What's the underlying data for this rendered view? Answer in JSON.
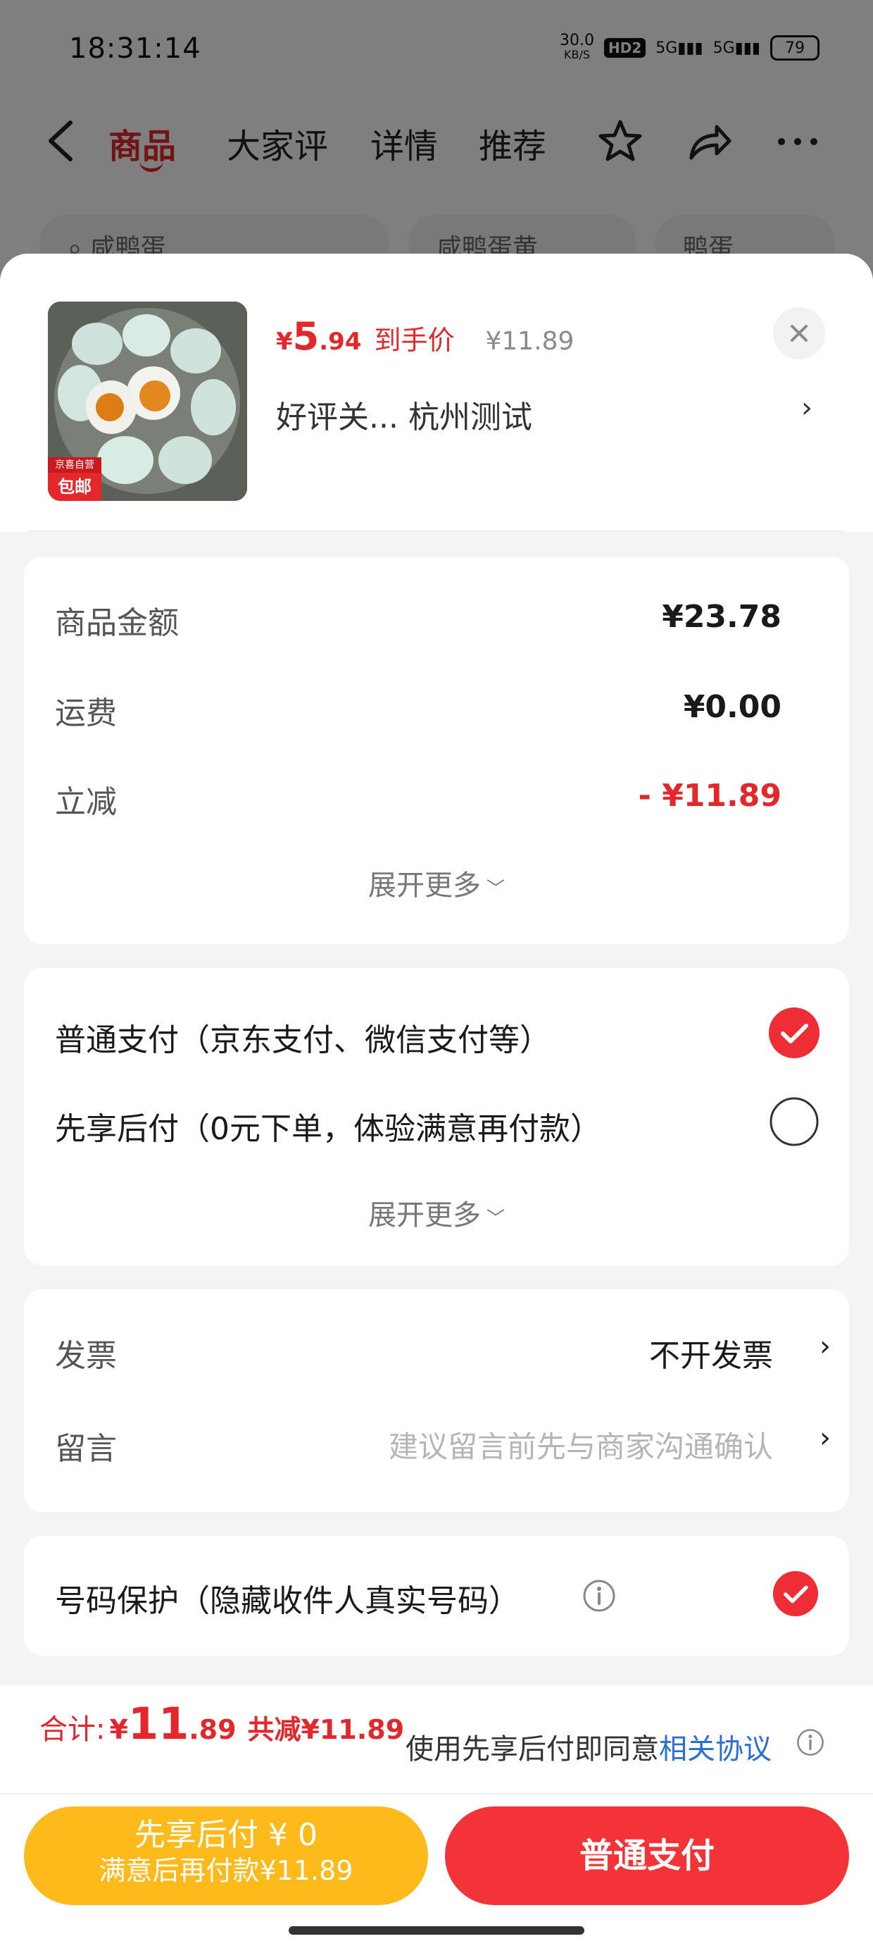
{
  "status_bar": {
    "time": "18:31:14",
    "net_speed": "30.0",
    "net_unit": "KB/S",
    "hd_label": "HD2",
    "sig1": "5G",
    "sig2": "5G",
    "battery": "79"
  },
  "nav": {
    "tabs": [
      "商品",
      "大家评",
      "详情",
      "推荐"
    ],
    "active_tab": "商品",
    "icons": [
      "back-icon",
      "star-icon",
      "share-icon",
      "more-icon"
    ],
    "chips": [
      "咸鸭蛋",
      "咸鸭蛋黄",
      "鸭蛋"
    ]
  },
  "product": {
    "badge_top": "京喜自营",
    "badge_main": "包邮",
    "price_currency": "¥",
    "price_int": "5",
    "price_dec": ".94",
    "price_tag": "到手价",
    "original_price": "¥11.89",
    "desc": "好评关...  杭州测试",
    "desc_chevron": "›"
  },
  "cost": {
    "rows": [
      {
        "label": "商品金额",
        "value": "¥23.78"
      },
      {
        "label": "运费",
        "value": "¥0.00"
      },
      {
        "label": "立减",
        "value": "- ¥11.89"
      }
    ],
    "expand_label": "展开更多"
  },
  "payment": {
    "options": [
      {
        "label": "普通支付（京东支付、微信支付等）",
        "selected": true
      },
      {
        "label": "先享后付（0元下单，体验满意再付款）",
        "selected": false
      }
    ],
    "expand_label": "展开更多"
  },
  "extras": {
    "invoice_label": "发票",
    "invoice_value": "不开发票",
    "message_label": "留言",
    "message_placeholder": "建议留言前先与商家沟通确认"
  },
  "privacy": {
    "label": "号码保护（隐藏收件人真实号码）",
    "checked": true
  },
  "summary": {
    "label": "合计:",
    "currency": "¥",
    "total_int": "11",
    "total_dec": ".89",
    "reduced": "共减¥11.89",
    "agree_text": "使用先享后付即同意",
    "agree_link": "相关协议"
  },
  "buttons": {
    "later_line1": "先享后付 ¥ 0",
    "later_line2": "满意后再付款¥11.89",
    "normal": "普通支付"
  },
  "colors": {
    "accent": "#e4272b",
    "pay_later": "#fdba1a",
    "pay_normal": "#f43338",
    "link": "#2a6fd6"
  }
}
